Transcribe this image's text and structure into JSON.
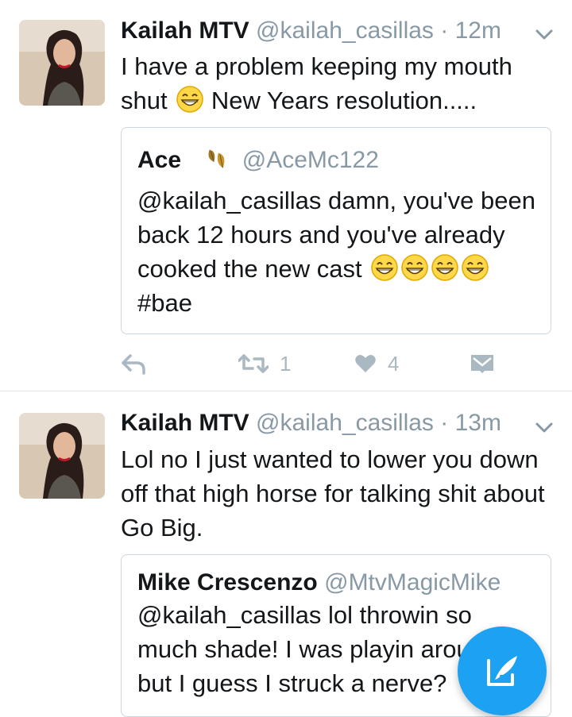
{
  "tweets": [
    {
      "name": "Kailah MTV",
      "handle": "@kailah_casillas",
      "time": "· 12m",
      "body": "I have a problem keeping my mouth shut",
      "body_suffix": " New Years resolution.....",
      "quote": {
        "name": "Ace",
        "handle": "@AceMc122",
        "body": "@kailah_casillas damn, you've been back 12 hours and you've already cooked the new cast",
        "hashtag": "#bae"
      },
      "actions": {
        "retweets": "1",
        "likes": "4"
      }
    },
    {
      "name": "Kailah MTV",
      "handle": "@kailah_casillas",
      "time": "· 13m",
      "body": "Lol no I just wanted to lower you down off that high horse for talking shit about Go Big.",
      "quote": {
        "name": "Mike Crescenzo",
        "handle": "@MtvMagicMike",
        "body": "@kailah_casillas lol throwin so much shade! I was playin around but I guess I struck a nerve?"
      }
    }
  ],
  "colors": {
    "accent": "#1da1f2",
    "muted": "#8899a6",
    "icon": "#aab8c2",
    "border": "#ccd6dd"
  },
  "icons": [
    "chevron-down-icon",
    "reply-icon",
    "retweet-icon",
    "heart-icon",
    "direct-message-icon",
    "compose-icon",
    "grin-emoji-icon",
    "leaves-icon"
  ]
}
